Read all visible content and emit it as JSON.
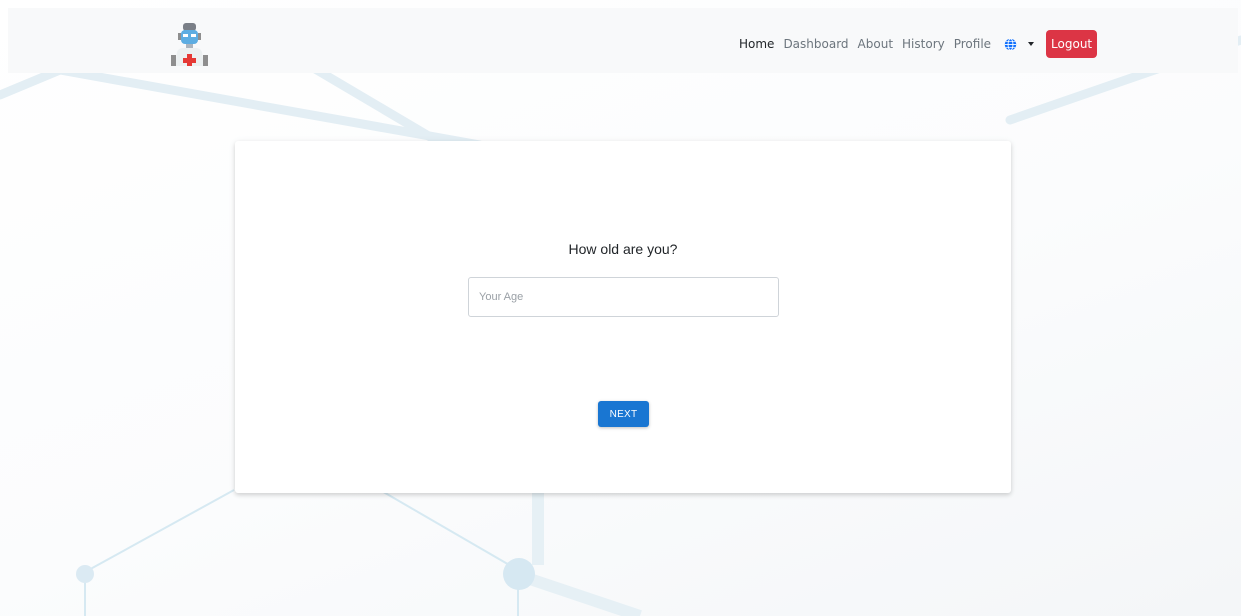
{
  "navbar": {
    "logo_icon": "doctor-robot-icon",
    "links": [
      {
        "label": "Home",
        "active": true
      },
      {
        "label": "Dashboard",
        "active": false
      },
      {
        "label": "About",
        "active": false
      },
      {
        "label": "History",
        "active": false
      },
      {
        "label": "Profile",
        "active": false
      }
    ],
    "language_icon": "globe-icon",
    "logout_label": "Logout"
  },
  "form": {
    "question": "How old are you?",
    "age_placeholder": "Your Age",
    "age_value": "",
    "next_label": "NEXT"
  },
  "colors": {
    "logout_bg": "#dc3545",
    "next_bg": "#1976d2",
    "globe": "#0d6efd",
    "navbar_bg": "#f8f9fa"
  }
}
